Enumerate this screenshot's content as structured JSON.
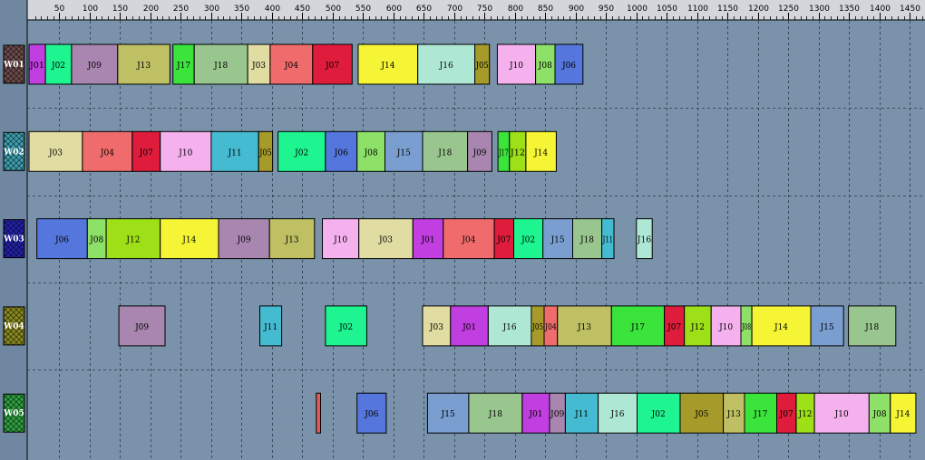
{
  "chart_data": {
    "type": "gantt",
    "xlim": [
      0,
      1470
    ],
    "ticks": [
      50,
      100,
      150,
      200,
      250,
      300,
      350,
      400,
      450,
      500,
      550,
      600,
      650,
      700,
      750,
      800,
      850,
      900,
      950,
      1000,
      1050,
      1100,
      1150,
      1200,
      1250,
      1300,
      1350,
      1400,
      1450
    ],
    "grid": true,
    "job_colors": {
      "J01": "#c13ee0",
      "J02": "#1ef590",
      "J03": "#e0dca2",
      "J04": "#f06c6c",
      "J05": "#a69a2a",
      "J06": "#5577dd",
      "J07": "#e01c3c",
      "J08": "#8de068",
      "J09": "#a986b0",
      "J10": "#f5b0ee",
      "J11": "#44bbd0",
      "J12": "#9ee018",
      "J13": "#bfbf64",
      "J14": "#f5f536",
      "J15": "#7a9ed0",
      "J16": "#aee8d4",
      "J17": "#3ae43a",
      "J18": "#99c68e",
      "": "#e05a5a"
    },
    "resources": [
      {
        "name": "W01",
        "swatch": "#6b4a4a",
        "tasks": [
          {
            "job": "J01",
            "start": 0,
            "end": 27
          },
          {
            "job": "J02",
            "start": 27,
            "end": 70
          },
          {
            "job": "J09",
            "start": 70,
            "end": 146
          },
          {
            "job": "J13",
            "start": 146,
            "end": 232
          },
          {
            "job": "J17",
            "start": 237,
            "end": 272
          },
          {
            "job": "J18",
            "start": 272,
            "end": 360
          },
          {
            "job": "J03",
            "start": 360,
            "end": 397
          },
          {
            "job": "J04",
            "start": 397,
            "end": 467
          },
          {
            "job": "J07",
            "start": 467,
            "end": 532
          },
          {
            "job": "J14",
            "start": 542,
            "end": 640
          },
          {
            "job": "J16",
            "start": 640,
            "end": 734
          },
          {
            "job": "J05",
            "start": 734,
            "end": 758
          },
          {
            "job": "J10",
            "start": 771,
            "end": 834
          },
          {
            "job": "J08",
            "start": 834,
            "end": 866
          },
          {
            "job": "J06",
            "start": 866,
            "end": 912
          }
        ]
      },
      {
        "name": "W02",
        "swatch": "#3fa0b0",
        "tasks": [
          {
            "job": "J03",
            "start": 0,
            "end": 88
          },
          {
            "job": "J04",
            "start": 88,
            "end": 170
          },
          {
            "job": "J07",
            "start": 170,
            "end": 216
          },
          {
            "job": "J10",
            "start": 216,
            "end": 300
          },
          {
            "job": "J11",
            "start": 300,
            "end": 378
          },
          {
            "job": "J05",
            "start": 378,
            "end": 401
          },
          {
            "job": "J02",
            "start": 410,
            "end": 488
          },
          {
            "job": "J06",
            "start": 488,
            "end": 540
          },
          {
            "job": "J08",
            "start": 540,
            "end": 586
          },
          {
            "job": "J15",
            "start": 586,
            "end": 648
          },
          {
            "job": "J18",
            "start": 648,
            "end": 722
          },
          {
            "job": "J09",
            "start": 722,
            "end": 762
          },
          {
            "job": "J17",
            "start": 772,
            "end": 791
          },
          {
            "job": "J12",
            "start": 791,
            "end": 818
          },
          {
            "job": "J14",
            "start": 818,
            "end": 868
          }
        ]
      },
      {
        "name": "W03",
        "swatch": "#2222aa",
        "tasks": [
          {
            "job": "J06",
            "start": 13,
            "end": 96
          },
          {
            "job": "J08",
            "start": 96,
            "end": 127
          },
          {
            "job": "J12",
            "start": 127,
            "end": 216
          },
          {
            "job": "J14",
            "start": 216,
            "end": 312
          },
          {
            "job": "J09",
            "start": 312,
            "end": 396
          },
          {
            "job": "J13",
            "start": 396,
            "end": 470
          },
          {
            "job": "J10",
            "start": 483,
            "end": 543
          },
          {
            "job": "J03",
            "start": 543,
            "end": 632
          },
          {
            "job": "J01",
            "start": 632,
            "end": 682
          },
          {
            "job": "J04",
            "start": 682,
            "end": 766
          },
          {
            "job": "J07",
            "start": 766,
            "end": 798
          },
          {
            "job": "J02",
            "start": 798,
            "end": 846
          },
          {
            "job": "J15",
            "start": 846,
            "end": 895
          },
          {
            "job": "J18",
            "start": 895,
            "end": 943
          },
          {
            "job": "J11",
            "start": 943,
            "end": 963
          },
          {
            "job": "J16",
            "start": 1000,
            "end": 1026
          }
        ]
      },
      {
        "name": "W04",
        "swatch": "#8a8a20",
        "tasks": [
          {
            "job": "J09",
            "start": 148,
            "end": 224
          },
          {
            "job": "J11",
            "start": 380,
            "end": 416
          },
          {
            "job": "J02",
            "start": 488,
            "end": 556
          },
          {
            "job": "J03",
            "start": 648,
            "end": 694
          },
          {
            "job": "J01",
            "start": 694,
            "end": 756
          },
          {
            "job": "J16",
            "start": 756,
            "end": 827
          },
          {
            "job": "J05",
            "start": 827,
            "end": 848
          },
          {
            "job": "J04",
            "start": 848,
            "end": 870
          },
          {
            "job": "J13",
            "start": 870,
            "end": 959
          },
          {
            "job": "J17",
            "start": 959,
            "end": 1046
          },
          {
            "job": "J07",
            "start": 1046,
            "end": 1079
          },
          {
            "job": "J12",
            "start": 1079,
            "end": 1123
          },
          {
            "job": "J10",
            "start": 1123,
            "end": 1172
          },
          {
            "job": "J08",
            "start": 1172,
            "end": 1190
          },
          {
            "job": "J14",
            "start": 1190,
            "end": 1287
          },
          {
            "job": "J15",
            "start": 1287,
            "end": 1341
          },
          {
            "job": "J18",
            "start": 1349,
            "end": 1427
          }
        ]
      },
      {
        "name": "W05",
        "swatch": "#2ea040",
        "tasks": [
          {
            "job": "",
            "start": 473,
            "end": 480
          },
          {
            "job": "J06",
            "start": 540,
            "end": 588
          },
          {
            "job": "J15",
            "start": 656,
            "end": 724
          },
          {
            "job": "J18",
            "start": 724,
            "end": 812
          },
          {
            "job": "J01",
            "start": 812,
            "end": 857
          },
          {
            "job": "J09",
            "start": 857,
            "end": 883
          },
          {
            "job": "J11",
            "start": 883,
            "end": 937
          },
          {
            "job": "J16",
            "start": 937,
            "end": 1001
          },
          {
            "job": "J02",
            "start": 1001,
            "end": 1072
          },
          {
            "job": "J05",
            "start": 1072,
            "end": 1143
          },
          {
            "job": "J13",
            "start": 1143,
            "end": 1178
          },
          {
            "job": "J17",
            "start": 1178,
            "end": 1231
          },
          {
            "job": "J07",
            "start": 1231,
            "end": 1263
          },
          {
            "job": "J12",
            "start": 1263,
            "end": 1293
          },
          {
            "job": "J10",
            "start": 1293,
            "end": 1383
          },
          {
            "job": "J08",
            "start": 1383,
            "end": 1418
          },
          {
            "job": "J14",
            "start": 1418,
            "end": 1460
          }
        ]
      }
    ]
  }
}
